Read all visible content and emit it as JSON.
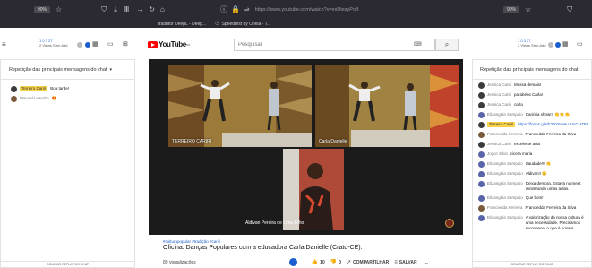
{
  "browser": {
    "left_zoom": "90%",
    "url": "https://www.youtube.com/watch?v=xxDtezyPoB",
    "right_zoom": "90%",
    "bookmarks": [
      "Tradutor DeepL - Deep...",
      "Speedtest by Ookla - T..."
    ]
  },
  "toolbar": {
    "stats_row1": "1 0 3 27",
    "stats_row2": "2 Views Strm Add"
  },
  "youtube": {
    "logo_text": "YouTube",
    "logo_sup": "BR",
    "search_placeholder": "Pesquisar"
  },
  "left_chat": {
    "title": "Repetição das principais mensagens do chat",
    "messages": [
      {
        "name": "Terreiro Cariri",
        "text": "Boa tarde!",
        "tagged": true
      },
      {
        "name": "Manoel Leandro",
        "text": "😍",
        "tagged": false
      }
    ],
    "footer": "OCULTAR REPLAY DO CHAT"
  },
  "video": {
    "participants": [
      "TERREIRO CARIRI",
      "Carla Danielle",
      "Aldivan Pereira de Lima Filho"
    ]
  },
  "info": {
    "hashtags": "#culturapopular #tradição #cariri",
    "title": "Oficina: Danças Populares com a educadora Carla Danielle (Crato-CE).",
    "views": "89 visualizações",
    "likes": "10",
    "dislikes": "0",
    "share": "COMPARTILHAR",
    "save": "SALVAR",
    "more": "..."
  },
  "right_chat": {
    "title": "Repetição das principais mensagens do chat",
    "messages": [
      {
        "name": "Jessica Cariri",
        "text": "Massa demais!"
      },
      {
        "name": "Jessica Cariri",
        "text": "parabéns Carla!"
      },
      {
        "name": "Jessica Cariri",
        "text": "carla"
      },
      {
        "name": "Elizangela Sampaio",
        "text": "Caririria show!!! 👏👏👏"
      },
      {
        "name": "Terreiro Cariri",
        "text": "https://forms.gle/E3RYFoteuJVnCHZF9",
        "tagged": true
      },
      {
        "name": "Franciedda Ferreira",
        "text": "Franciedda Ferreira da Silva"
      },
      {
        "name": "Jessica Cariri",
        "text": "excelente aula"
      },
      {
        "name": "Joyce Silva",
        "text": "cicera maria"
      },
      {
        "name": "Elizangela Sampaio",
        "text": "Saudade!!! 👏"
      },
      {
        "name": "Elizangela Sampaio",
        "text": "Aldivan!! 😊"
      },
      {
        "name": "Elizangela Sampaio",
        "text": "Deixa demora. Estava no meet ministrando umas aulas."
      },
      {
        "name": "Elizangela Sampaio",
        "text": "Que bom!"
      },
      {
        "name": "Franciedda Ferreira",
        "text": "Franciedda Ferreira da Silva"
      },
      {
        "name": "Elizangela Sampaio",
        "text": "A valorização da nossa cultura é uma necessidade. Precisamos reconhecer o que é nosso!"
      }
    ],
    "footer": "OCULTAR REPLAY DO CHAT"
  },
  "colors": {
    "yt_red": "#ff0000",
    "browser_bg": "#2b2a33",
    "tag_yellow": "#f6d34a"
  }
}
